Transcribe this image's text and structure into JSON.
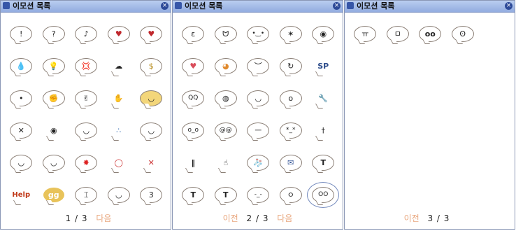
{
  "windows": [
    {
      "title": "이모션 목록",
      "page": "1 / 3",
      "prev": "",
      "next": "다음",
      "emotes": [
        "!",
        "?",
        "♪",
        "♥",
        "♥",
        "💧",
        "💡",
        "💢",
        "☁",
        "$",
        "•",
        "✊",
        "✌",
        "✋",
        "◡",
        "✕",
        "◉",
        "◡",
        "∴",
        "◡",
        "◡",
        "◡",
        "✸",
        "◯",
        "✕",
        "Help",
        "gg",
        "⌶",
        "◡",
        "3"
      ]
    },
    {
      "title": "이모션 목록",
      "page": "2 / 3",
      "prev": "이전",
      "next": "다음",
      "emotes": [
        "ε",
        "ᗢ",
        "•‿•",
        "✶",
        "◉",
        "♥",
        "◕",
        "︶",
        "↻",
        "SP",
        "QQ",
        "◍",
        "◡",
        "o",
        "🔧",
        "o_o",
        "@@",
        "ㅡ",
        "*_*",
        "†",
        "‖",
        "☝",
        "🧦",
        "✉",
        "T",
        "T",
        "T",
        "-_-",
        "ㅇ",
        "OO"
      ]
    },
    {
      "title": "이모션 목록",
      "page": "3 / 3",
      "prev": "이전",
      "next": "",
      "emotes": [
        "ㅠ",
        "ㅁ",
        "oo",
        "ʘ"
      ]
    }
  ]
}
